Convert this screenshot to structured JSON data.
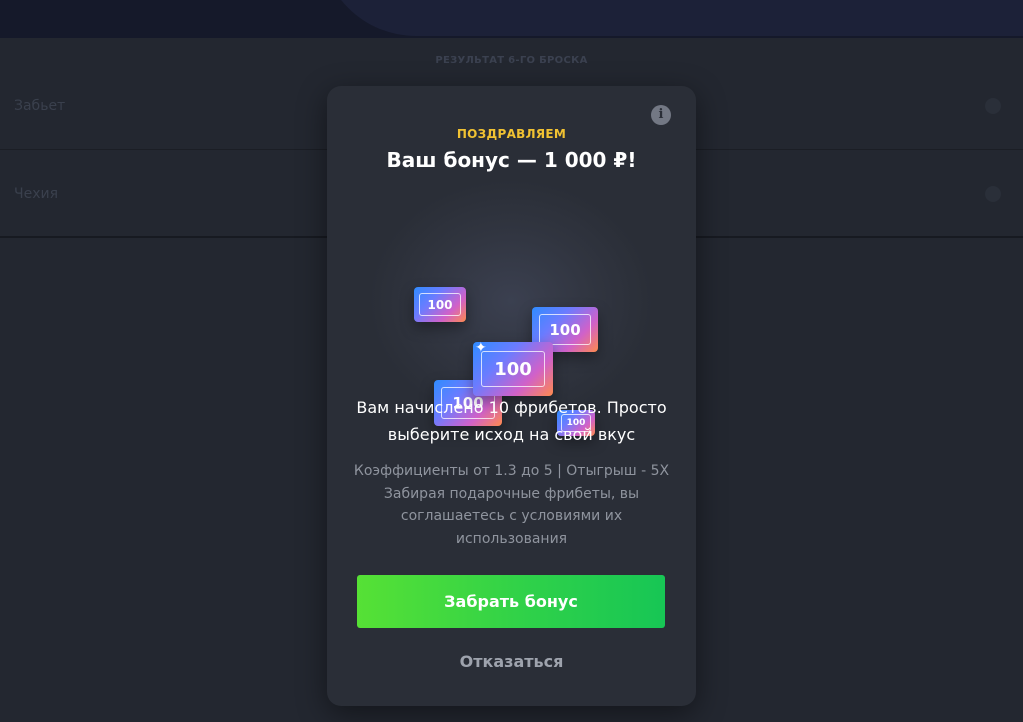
{
  "background": {
    "section_title": "РЕЗУЛЬТАТ 6-ГО БРОСКА",
    "rows": [
      {
        "label": "Забьет"
      },
      {
        "label": "Чехия"
      }
    ]
  },
  "modal": {
    "info_icon_glyph": "i",
    "overline": "ПОЗДРАВЛЯЕМ",
    "title": "Ваш бонус — 1 000 ₽!",
    "tickets": [
      "100",
      "100",
      "100",
      "100",
      "100"
    ],
    "main_text": "Вам начислено 10 фрибетов. Просто выберите исход на свой вкус",
    "sub_text": "Коэффициенты от 1.3 до 5 | Отыгрыш - 5Х Забирая подарочные фрибеты, вы соглашаетесь с условиями их использования",
    "cta_label": "Забрать бонус",
    "decline_label": "Отказаться"
  },
  "colors": {
    "overline": "#f1c232",
    "cta_start": "#56e135",
    "cta_end": "#17c655",
    "modal_bg": "#2a2e37"
  }
}
